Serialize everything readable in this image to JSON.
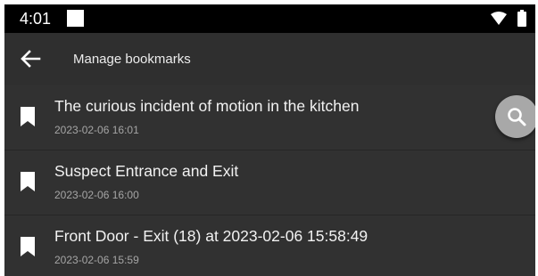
{
  "status_bar": {
    "time": "4:01",
    "notification_icon": "square-notification-icon",
    "wifi_icon": "wifi-icon",
    "battery_icon": "battery-icon"
  },
  "app_bar": {
    "back_icon": "arrow-back-icon",
    "title": "Manage bookmarks"
  },
  "bookmarks": [
    {
      "title": "The curious incident of motion in the kitchen",
      "time": "2023-02-06 16:01"
    },
    {
      "title": "Suspect Entrance and Exit",
      "time": "2023-02-06 16:00"
    },
    {
      "title": "Front Door - Exit (18) at 2023-02-06 15:58:49",
      "time": "2023-02-06 15:59"
    }
  ],
  "fab": {
    "icon": "search-icon"
  },
  "colors": {
    "background": "#303030",
    "status_bar": "#000000",
    "fab": "#a8a8a8",
    "text_primary": "#f2f2f2",
    "text_secondary": "#a5a5a5"
  }
}
